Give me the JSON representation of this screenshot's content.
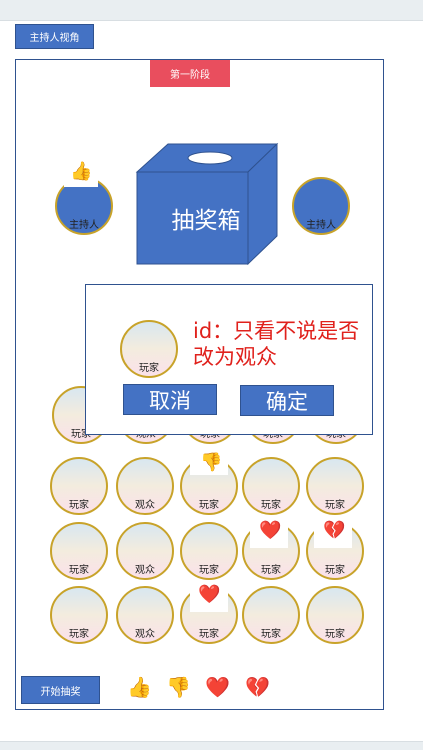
{
  "header": {
    "host_view_label": "主持人视角"
  },
  "stage": {
    "label": "第一阶段"
  },
  "lottery_box": {
    "label": "抽奖箱",
    "color": "#4472c4"
  },
  "hosts": [
    {
      "label": "主持人",
      "reaction": "👍"
    },
    {
      "label": "主持人"
    }
  ],
  "dialog": {
    "avatar_label": "玩家",
    "message": "id：只看不说是否改为观众",
    "cancel_label": "取消",
    "confirm_label": "确定",
    "message_color": "#e0211c"
  },
  "grid": {
    "row1": [
      "玩家",
      "观众",
      "玩家",
      "玩家",
      "玩家"
    ],
    "row2": [
      "玩家",
      "观众",
      "玩家",
      "玩家",
      "玩家"
    ],
    "row3": [
      "玩家",
      "观众",
      "玩家",
      "玩家",
      "玩家"
    ],
    "row4": [
      "玩家",
      "观众",
      "玩家",
      "玩家",
      "玩家"
    ]
  },
  "grid_reactions": {
    "r2c3": "👎",
    "r3c4": "❤️",
    "r3c5": "💔",
    "r4c3": "❤️"
  },
  "footer": {
    "start_label": "开始抽奖",
    "reactions": [
      "👍",
      "👎",
      "❤️",
      "💔"
    ]
  },
  "colors": {
    "primary": "#4472c4",
    "stage": "#e94e5e",
    "avatar_border": "#c8a32a"
  }
}
